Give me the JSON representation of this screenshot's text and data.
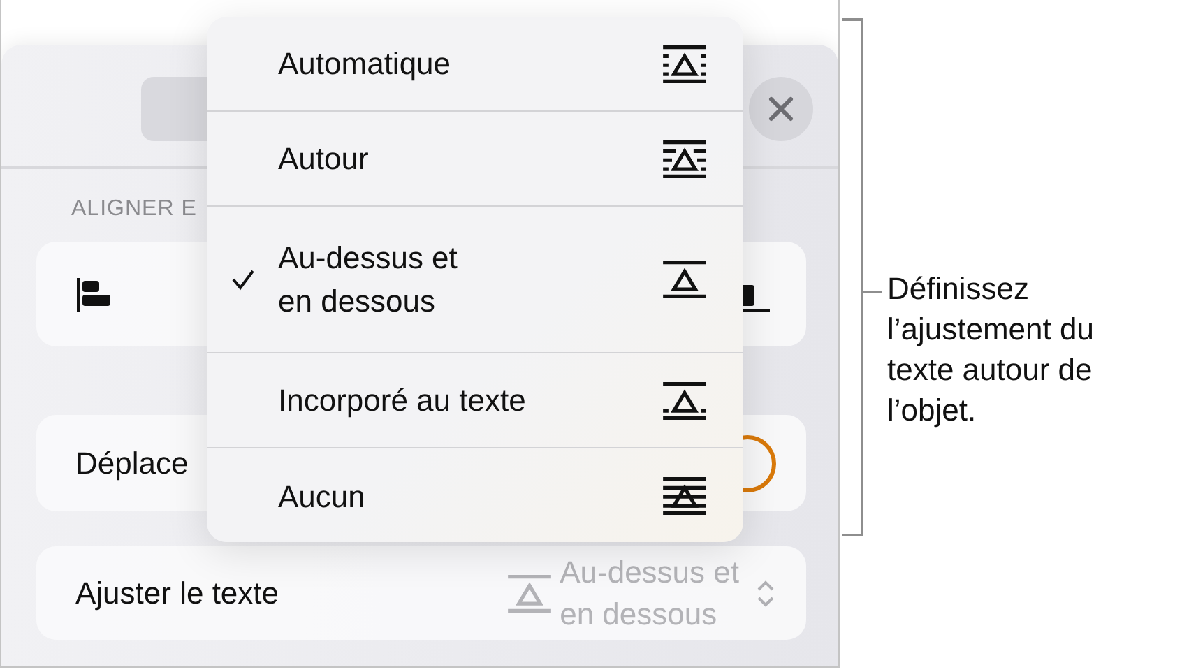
{
  "sheet": {
    "section_label": "ALIGNER E",
    "rows": [
      {
        "kind": "align"
      },
      {
        "kind": "switch",
        "label": "Déplace"
      },
      {
        "kind": "value",
        "label": "Ajuster le texte",
        "value": "Au-dessus et\nen dessous"
      }
    ]
  },
  "menu": {
    "items": [
      {
        "label": "Automatique",
        "kind": "automatic",
        "selected": false
      },
      {
        "label": "Autour",
        "kind": "around",
        "selected": false
      },
      {
        "label": "Au-dessus et\nen dessous",
        "kind": "above_below",
        "selected": true
      },
      {
        "label": "Incorporé au texte",
        "kind": "inline",
        "selected": false
      },
      {
        "label": "Aucun",
        "kind": "none",
        "selected": false
      }
    ]
  },
  "callout": {
    "text": "Définissez\nl’ajustement du\ntexte autour de\nl’objet."
  }
}
